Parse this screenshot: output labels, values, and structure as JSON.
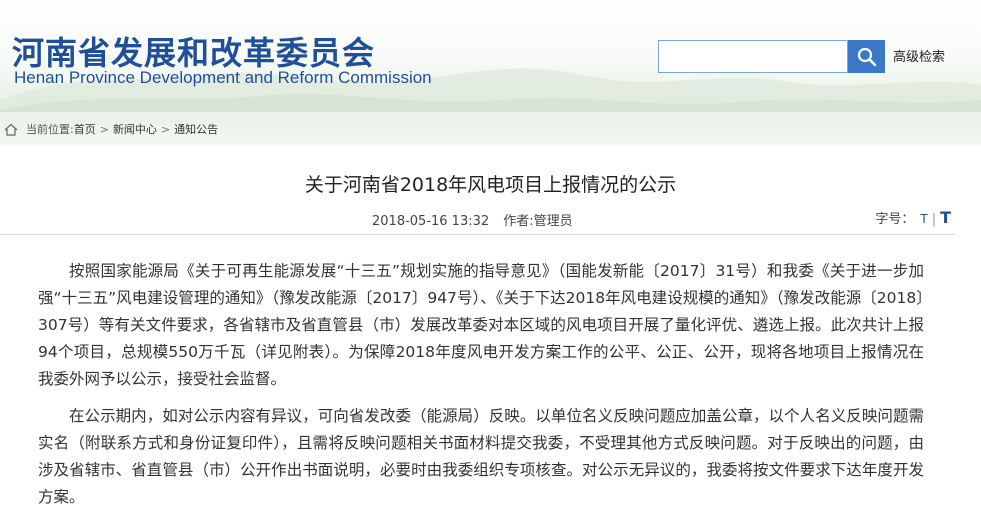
{
  "header": {
    "title": "河南省发展和改革委员会",
    "subtitle": "Henan Province Development and Reform Commission",
    "search_placeholder": "",
    "advanced_search": "高级检索"
  },
  "breadcrumb": {
    "prefix": "当前位置:",
    "items": [
      "首页",
      "新闻中心",
      "通知公告"
    ],
    "separator": ">"
  },
  "article": {
    "title": "关于河南省2018年风电项目上报情况的公示",
    "date": "2018-05-16 13:32",
    "author": "作者:管理员",
    "font_size_label": "字号：",
    "font_small": "T",
    "font_sep": "|",
    "font_large": "T",
    "paragraphs": [
      "按照国家能源局《关于可再生能源发展“十三五”规划实施的指导意见》（国能发新能〔2017〕31号）和我委《关于进一步加强“十三五”风电建设管理的通知》（豫发改能源〔2017〕947号）、《关于下达2018年风电建设规模的通知》（豫发改能源〔2018〕307号）等有关文件要求，各省辖市及省直管县（市）发展改革委对本区域的风电项目开展了量化评优、遴选上报。此次共计上报94个项目，总规模550万千瓦（详见附表）。为保障2018年度风电开发方案工作的公平、公正、公开，现将各地项目上报情况在我委外网予以公示，接受社会监督。",
      "在公示期内，如对公示内容有异议，可向省发改委（能源局）反映。以单位名义反映问题应加盖公章，以个人名义反映问题需实名（附联系方式和身份证复印件），且需将反映问题相关书面材料提交我委，不受理其他方式反映问题。对于反映出的问题，由涉及省辖市、省直管县（市）公开作出书面说明，必要时由我委组织专项核查。对公示无异议的，我委将按文件要求下达年度开发方案。"
    ]
  },
  "colors": {
    "brand_blue": "#1f4f9a",
    "search_button": "#3a78c8"
  }
}
